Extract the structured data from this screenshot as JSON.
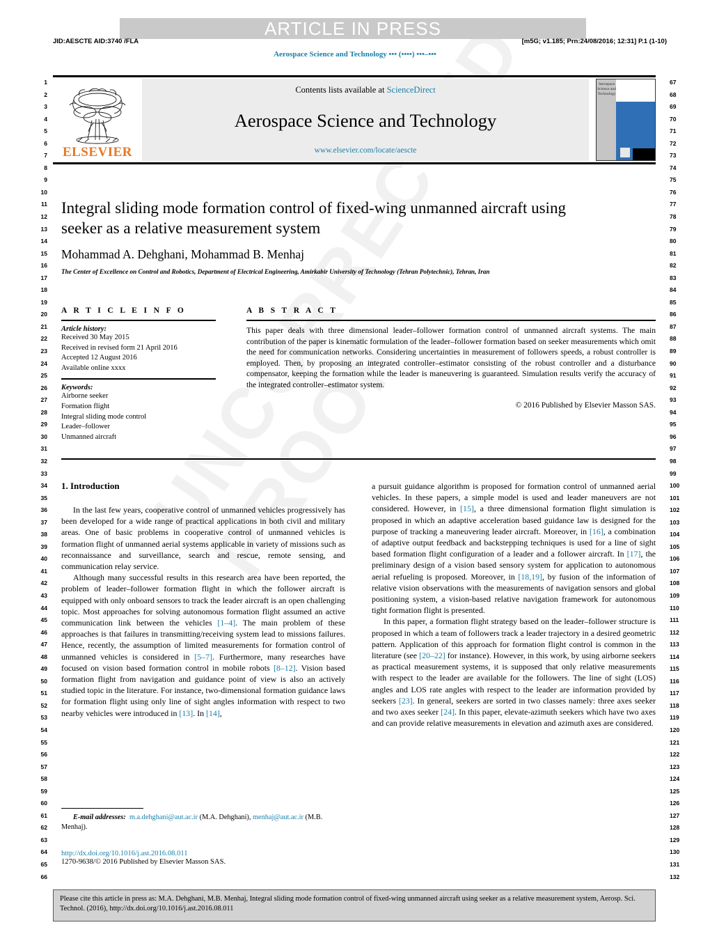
{
  "watermark_text": "UNCORRECTED PROOF",
  "header": {
    "banner": "ARTICLE IN PRESS",
    "jid": "JID:AESCTE   AID:3740 /FLA",
    "prn": "[m5G; v1.185; Prn:24/08/2016; 12:31] P.1 (1-10)",
    "running_title": "Aerospace Science and Technology ••• (••••) •••–•••"
  },
  "masthead": {
    "publisher": "ELSEVIER",
    "contents_prefix": "Contents lists available at ",
    "contents_link": "ScienceDirect",
    "journal_title": "Aerospace Science and Technology",
    "journal_url": "www.elsevier.com/locate/aescte",
    "cover_title": "Aerospace Science and Technology"
  },
  "title_block": {
    "title": "Integral sliding mode formation control of fixed-wing unmanned aircraft using seeker as a relative measurement system",
    "authors": "Mohammad A. Dehghani, Mohammad B. Menhaj",
    "affiliation": "The Center of Excellence on Control and Robotics, Department of Electrical Engineering, Amirkabir University of Technology (Tehran Polytechnic), Tehran, Iran"
  },
  "article_info": {
    "heading": "A R T I C L E    I N F O",
    "history_label": "Article history:",
    "history": [
      "Received 30 May 2015",
      "Received in revised form 21 April 2016",
      "Accepted 12 August 2016",
      "Available online xxxx"
    ],
    "keywords_label": "Keywords:",
    "keywords": [
      "Airborne seeker",
      "Formation flight",
      "Integral sliding mode control",
      "Leader–follower",
      "Unmanned aircraft"
    ]
  },
  "abstract": {
    "heading": "A B S T R A C T",
    "text": "This paper deals with three dimensional leader–follower formation control of unmanned aircraft systems. The main contribution of the paper is kinematic formulation of the leader–follower formation based on seeker measurements which omit the need for communication networks. Considering uncertainties in measurement of followers speeds, a robust controller is employed. Then, by proposing an integrated controller–estimator consisting of the robust controller and a disturbance compensator, keeping the formation while the leader is maneuvering is guaranteed. Simulation results verify the accuracy of the integrated controller–estimator system.",
    "copyright": "© 2016 Published by Elsevier Masson SAS."
  },
  "body": {
    "section_title": "1. Introduction",
    "left_paragraphs": [
      "In the last few years, cooperative control of unmanned vehicles progressively has been developed for a wide range of practical applications in both civil and military areas. One of basic problems in cooperative control of unmanned vehicles is formation flight of unmanned aerial systems applicable in variety of missions such as reconnaissance and surveillance, search and rescue, remote sensing, and communication relay service."
    ],
    "left_paragraph_2_parts": [
      {
        "t": "Although many successful results in this research area have been reported, the problem of leader–follower formation flight in which the follower aircraft is equipped with only onboard sensors to track the leader aircraft is an open challenging topic. Most approaches for solving autonomous formation flight assumed an active communication link between the vehicles "
      },
      {
        "t": "[1–4]",
        "ref": true
      },
      {
        "t": ". The main problem of these approaches is that failures in transmitting/receiving system lead to missions failures. Hence, recently, the assumption of limited measurements for formation control of unmanned vehicles is considered in "
      },
      {
        "t": "[5–7]",
        "ref": true
      },
      {
        "t": ". Furthermore, many researches have focused on vision based formation control in mobile robots "
      },
      {
        "t": "[8–12]",
        "ref": true
      },
      {
        "t": ". Vision based formation flight from navigation and guidance point of view is also an actively studied topic in the literature. For instance, two-dimensional formation guidance laws for formation flight using only line of sight angles information with respect to two nearby vehicles were introduced in "
      },
      {
        "t": "[13]",
        "ref": true
      },
      {
        "t": ". In "
      },
      {
        "t": "[14]",
        "ref": true
      },
      {
        "t": ","
      }
    ],
    "right_paragraph_1_parts": [
      {
        "t": "a pursuit guidance algorithm is proposed for formation control of unmanned aerial vehicles. In these papers, a simple model is used and leader maneuvers are not considered. However, in "
      },
      {
        "t": "[15]",
        "ref": true
      },
      {
        "t": ", a three dimensional formation flight simulation is proposed in which an adaptive acceleration based guidance law is designed for the purpose of tracking a maneuvering leader aircraft. Moreover, in "
      },
      {
        "t": "[16]",
        "ref": true
      },
      {
        "t": ", a combination of adaptive output feedback and backstepping techniques is used for a line of sight based formation flight configuration of a leader and a follower aircraft. In "
      },
      {
        "t": "[17]",
        "ref": true
      },
      {
        "t": ", the preliminary design of a vision based sensory system for application to autonomous aerial refueling is proposed. Moreover, in "
      },
      {
        "t": "[18,19]",
        "ref": true
      },
      {
        "t": ", by fusion of the information of relative vision observations with the measurements of navigation sensors and global positioning system, a vision-based relative navigation framework for autonomous tight formation flight is presented."
      }
    ],
    "right_paragraph_2_parts": [
      {
        "t": "In this paper, a formation flight strategy based on the leader–follower structure is proposed in which a team of followers track a leader trajectory in a desired geometric pattern. Application of this approach for formation flight control is common in the literature (see "
      },
      {
        "t": "[20–22]",
        "ref": true
      },
      {
        "t": " for instance). However, in this work, by using airborne seekers as practical measurement systems, it is supposed that only relative measurements with respect to the leader are available for the followers. The line of sight (LOS) angles and LOS rate angles with respect to the leader are information provided by seekers "
      },
      {
        "t": "[23]",
        "ref": true
      },
      {
        "t": ". In general, seekers are sorted in two classes namely: three axes seeker and two axes seeker "
      },
      {
        "t": "[24]",
        "ref": true
      },
      {
        "t": ". In this paper, elevate-azimuth seekers which have two axes and can provide relative measurements in elevation and azimuth axes are considered."
      }
    ]
  },
  "footnote": {
    "label": "E-mail addresses:",
    "email1": "m.a.dehghani@aut.ac.ir",
    "author1": " (M.A. Dehghani), ",
    "email2": "menhaj@aut.ac.ir",
    "author2": " (M.B. Menhaj)."
  },
  "doi_block": {
    "doi": "http://dx.doi.org/10.1016/j.ast.2016.08.011",
    "issn": "1270-9638/© 2016 Published by Elsevier Masson SAS."
  },
  "cite_box": {
    "text": "Please cite this article in press as: M.A. Dehghani, M.B. Menhaj, Integral sliding mode formation control of fixed-wing unmanned aircraft using seeker as a relative measurement system, Aerosp. Sci. Technol. (2016), http://dx.doi.org/10.1016/j.ast.2016.08.011"
  },
  "line_numbers": {
    "left_start": 1,
    "left_end": 66,
    "right_start": 67,
    "right_end": 132
  },
  "colors": {
    "link": "#1a7fa8",
    "elsevier_orange": "#E87722",
    "banner_gray": "#c9c9c9",
    "masthead_gray": "#ececec",
    "cite_gray": "#d2d2d2",
    "cover_blue": "#2f6fb5"
  }
}
